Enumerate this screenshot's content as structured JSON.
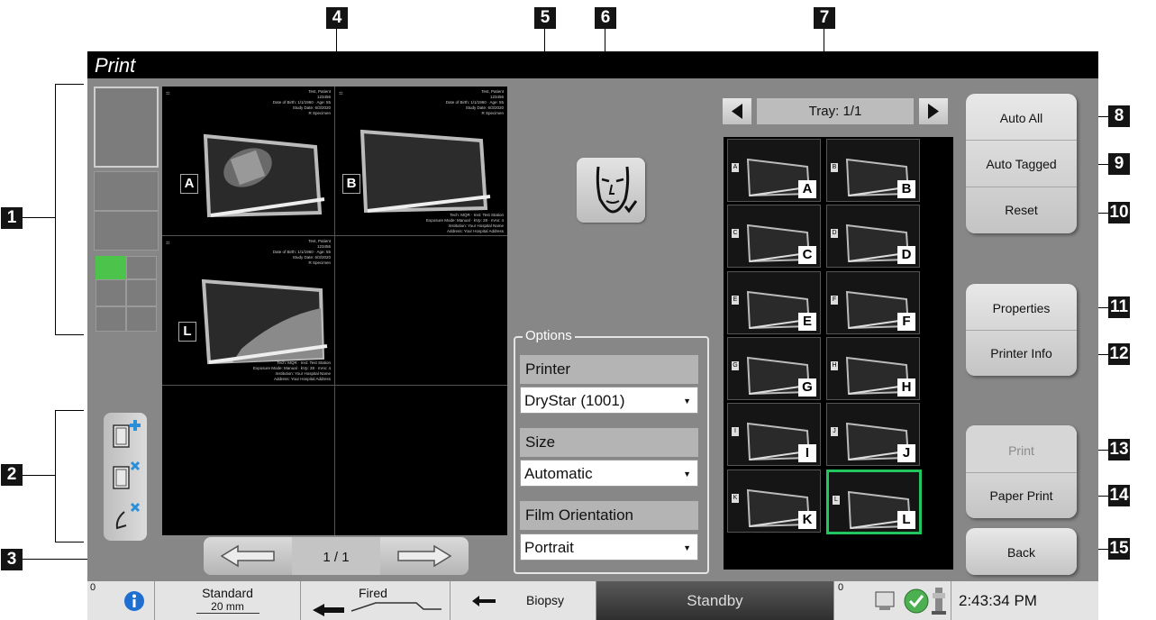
{
  "callouts": [
    "1",
    "2",
    "3",
    "4",
    "5",
    "6",
    "7",
    "8",
    "9",
    "10",
    "11",
    "12",
    "13",
    "14",
    "15"
  ],
  "window": {
    "title": "Print"
  },
  "previews": [
    {
      "letter": "A",
      "text": "Test, Patient\n123456\nDate of Birth: 1/1/1960 · Age: 55\nStudy Date: 6/3/2020\nR Specimen",
      "footer": "Tech: MQR · Inst: Test Station\nExposure Mode: Manual · kVp: 28 · mAs: 4\nInstitution: Your Hospital Name\nAddress: Your Hospital Address"
    },
    {
      "letter": "B",
      "text": "Test, Patient\n123456\nDate of Birth: 1/1/1960 · Age: 55\nStudy Date: 6/3/2020\nR Specimen",
      "footer": "Tech: MQR · Inst: Test Station\nExposure Mode: Manual · kVp: 28 · mAs: 4\nInstitution: Your Hospital Name\nAddress: Your Hospital Address"
    },
    {
      "letter": "L",
      "text": "Test, Patient\n123456\nDate of Birth: 1/1/1960 · Age: 55\nStudy Date: 6/3/2020\nR Specimen",
      "footer": "Tech: MQR · Inst: Test Station\nExposure Mode: Manual · kVp: 28 · mAs: 4\nInstitution: Your Hospital Name\nAddress: Your Hospital Address"
    }
  ],
  "page_nav": {
    "indicator": "1 / 1"
  },
  "options": {
    "legend": "Options",
    "printer_label": "Printer",
    "printer_value": "DryStar (1001)",
    "size_label": "Size",
    "size_value": "Automatic",
    "orientation_label": "Film Orientation",
    "orientation_value": "Portrait"
  },
  "tray": {
    "label": "Tray: 1/1",
    "tiles": [
      "A",
      "B",
      "C",
      "D",
      "E",
      "F",
      "G",
      "H",
      "I",
      "J",
      "K",
      "L"
    ],
    "selected": "L"
  },
  "buttons": {
    "auto_all": "Auto All",
    "auto_tagged": "Auto Tagged",
    "reset": "Reset",
    "properties": "Properties",
    "printer_info": "Printer Info",
    "print": "Print",
    "paper_print": "Paper Print",
    "back": "Back"
  },
  "status": {
    "count_left": "0",
    "compression": "Standard",
    "compression_sub": "20 mm",
    "fired": "Fired",
    "biopsy": "Biopsy",
    "state": "Standby",
    "count_right": "0",
    "time": "2:43:34 PM"
  },
  "colors": {
    "app_bg": "#878787",
    "select_green": "#22c55e",
    "thumb_green": "#4cc44c"
  }
}
